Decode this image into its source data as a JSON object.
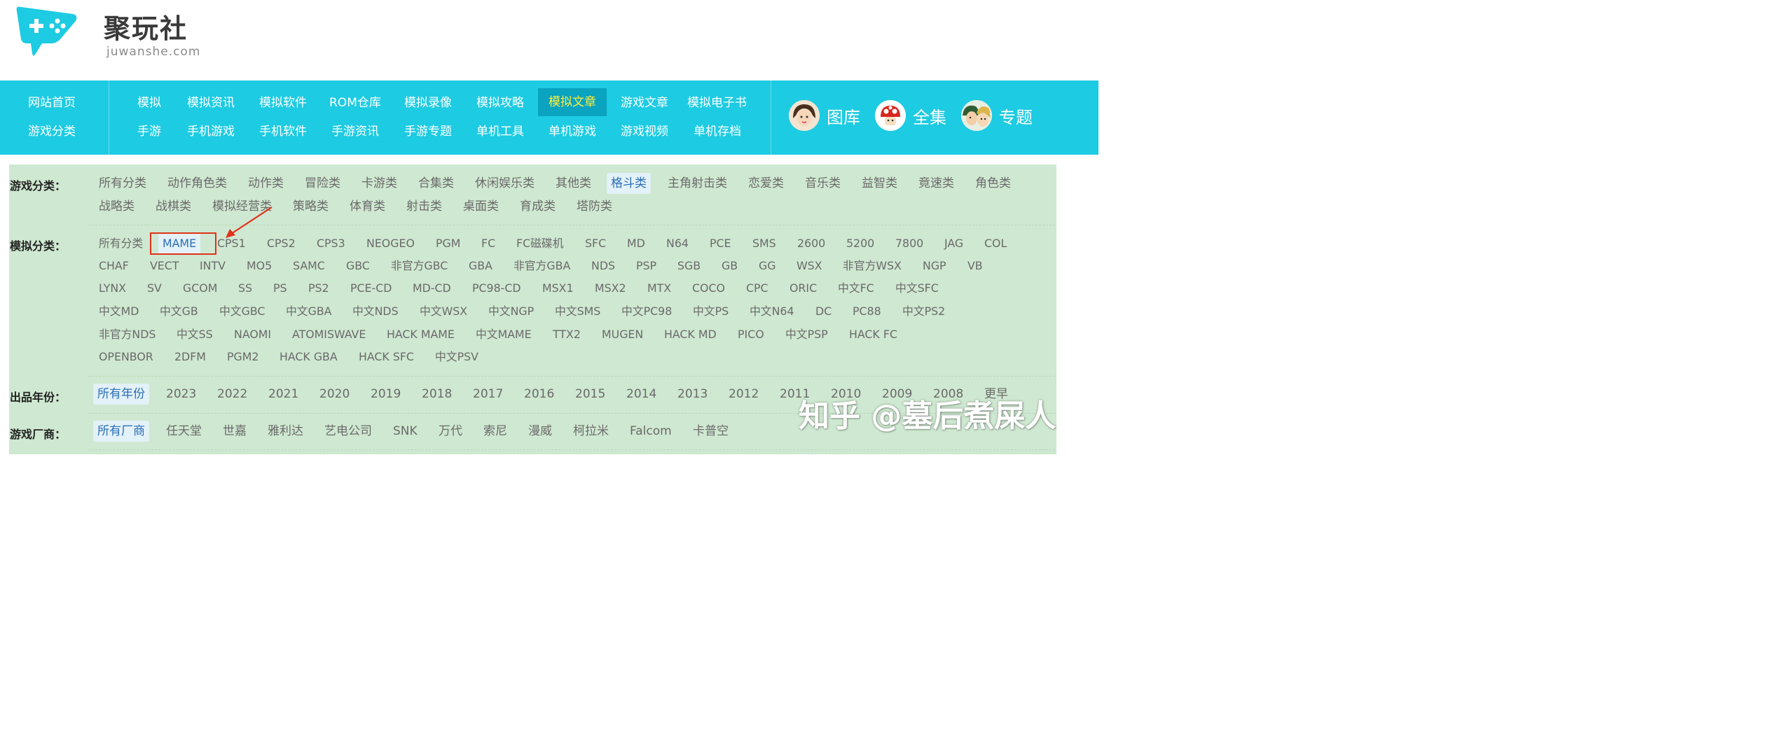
{
  "logo": {
    "name_cn": "聚玩社",
    "domain": "juwanshe.com"
  },
  "nav": {
    "left": [
      {
        "label": "网站首页",
        "name": "nav-home"
      },
      {
        "label": "游戏分类",
        "name": "nav-game-categories"
      }
    ],
    "row1": [
      "模拟",
      "模拟资讯",
      "模拟软件",
      "ROM仓库",
      "模拟录像",
      "模拟攻略",
      "模拟文章",
      "游戏文章",
      "模拟电子书"
    ],
    "row2": [
      "手游",
      "手机游戏",
      "手机软件",
      "手游资讯",
      "手游专题",
      "单机工具",
      "单机游戏",
      "游戏视频",
      "单机存档"
    ],
    "active": "模拟文章",
    "features": [
      {
        "label": "图库",
        "icon": "portrait-girl-avatar-icon"
      },
      {
        "label": "全集",
        "icon": "mushroom-avatar-icon"
      },
      {
        "label": "专题",
        "icon": "character-pair-avatar-icon"
      }
    ]
  },
  "filters": {
    "game_category": {
      "label": "游戏分类：",
      "selected": "格斗类",
      "items": [
        "所有分类",
        "动作角色类",
        "动作类",
        "冒险类",
        "卡游类",
        "合集类",
        "休闲娱乐类",
        "其他类",
        "格斗类",
        "主角射击类",
        "恋爱类",
        "音乐类",
        "益智类",
        "竟速类",
        "角色类",
        "战略类",
        "战棋类",
        "模拟经营类",
        "策略类",
        "体育类",
        "射击类",
        "桌面类",
        "育成类",
        "塔防类"
      ]
    },
    "emulator_category": {
      "label": "模拟分类：",
      "selected": "MAME",
      "items": [
        "所有分类",
        "MAME",
        "CPS1",
        "CPS2",
        "CPS3",
        "NEOGEO",
        "PGM",
        "FC",
        "FC磁碟机",
        "SFC",
        "MD",
        "N64",
        "PCE",
        "SMS",
        "2600",
        "5200",
        "7800",
        "JAG",
        "COL",
        "CHAF",
        "VECT",
        "INTV",
        "MO5",
        "SAMC",
        "GBC",
        "非官方GBC",
        "GBA",
        "非官方GBA",
        "NDS",
        "PSP",
        "SGB",
        "GB",
        "GG",
        "WSX",
        "非官方WSX",
        "NGP",
        "VB",
        "LYNX",
        "SV",
        "GCOM",
        "SS",
        "PS",
        "PS2",
        "PCE-CD",
        "MD-CD",
        "PC98-CD",
        "MSX1",
        "MSX2",
        "MTX",
        "COCO",
        "CPC",
        "ORIC",
        "中文FC",
        "中文SFC",
        "中文MD",
        "中文GB",
        "中文GBC",
        "中文GBA",
        "中文NDS",
        "中文WSX",
        "中文NGP",
        "中文SMS",
        "中文PC98",
        "中文PS",
        "中文N64",
        "DC",
        "PC88",
        "中文PS2",
        "非官方NDS",
        "中文SS",
        "NAOMI",
        "ATOMISWAVE",
        "HACK MAME",
        "中文MAME",
        "TTX2",
        "MUGEN",
        "HACK MD",
        "PICO",
        "中文PSP",
        "HACK FC",
        "OPENBOR",
        "2DFM",
        "PGM2",
        "HACK GBA",
        "HACK SFC",
        "中文PSV"
      ]
    },
    "release_year": {
      "label": "出品年份：",
      "selected": "所有年份",
      "items": [
        "所有年份",
        "2023",
        "2022",
        "2021",
        "2020",
        "2019",
        "2018",
        "2017",
        "2016",
        "2015",
        "2014",
        "2013",
        "2012",
        "2011",
        "2010",
        "2009",
        "2008",
        "更早"
      ]
    },
    "manufacturer": {
      "label": "游戏厂商：",
      "selected": "所有厂商",
      "items": [
        "所有厂商",
        "任天堂",
        "世嘉",
        "雅利达",
        "艺电公司",
        "SNK",
        "万代",
        "索尼",
        "漫威",
        "柯拉米",
        "Falcom",
        "卡普空"
      ]
    }
  },
  "watermark": "知乎 @墓后煮屎人",
  "colors": {
    "nav_bg": "#1dcbe2",
    "nav_active_bg": "#0aa3c0",
    "nav_active_text": "#ffef3a",
    "panel_bg": "#cfe8d1",
    "selected_tag_text": "#2a6fb6",
    "annotation_red": "#e0321b"
  }
}
